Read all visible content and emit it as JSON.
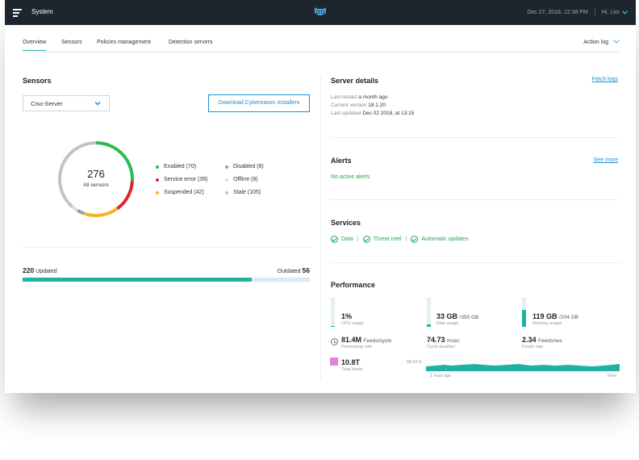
{
  "topbar": {
    "menu_icon": "hamburger-icon",
    "title": "System",
    "logo_icon": "owl-logo-icon",
    "datetime": "Dec 27, 2018, 12:38 PM",
    "user": "Hi, Lior",
    "user_chevron": "⌄"
  },
  "tabs": [
    {
      "label": "Overview",
      "active": true
    },
    {
      "label": "Sensors",
      "active": false
    },
    {
      "label": "Policies management",
      "active": false
    },
    {
      "label": "Detection servers",
      "active": false
    }
  ],
  "action_log": "Action log",
  "sensors": {
    "title": "Sensors",
    "server_select": "Ciso-Server",
    "download_button": "Download Cybereason Installers",
    "total": "276",
    "total_label": "All sensors",
    "legend": [
      {
        "label": "Enabled (70)",
        "color": "#2dba4e",
        "count": 70
      },
      {
        "label": "Disabled (8)",
        "color": "#8a9eaf",
        "count": 8
      },
      {
        "label": "Service error (39)",
        "color": "#e0242e",
        "count": 39
      },
      {
        "label": "Offline (8)",
        "color": "#d7dde2",
        "count": 8
      },
      {
        "label": "Suspended (42)",
        "color": "#f4b42a",
        "count": 42
      },
      {
        "label": "Stale (105)",
        "color": "#bfc4c8",
        "count": 105
      }
    ],
    "updated_count": "220",
    "updated_label": "Updated",
    "outdated_label": "Outdated",
    "outdated_count": "56",
    "updated_fraction": 0.797
  },
  "server_details": {
    "title": "Server details",
    "fetch_logs": "Fetch logs",
    "last_restart_label": "Last restart",
    "last_restart_value": "a month ago",
    "version_label": "Current version",
    "version_value": "18.1.20",
    "updated_label": "Last updated",
    "updated_value": "Dec 02 2018, at 13:15"
  },
  "alerts": {
    "title": "Alerts",
    "see_more": "See more",
    "status": "No active alerts"
  },
  "services": {
    "title": "Services",
    "items": [
      "Data",
      "Threat intel",
      "Automatic updates"
    ],
    "separator": "|"
  },
  "performance": {
    "title": "Performance",
    "cpu": {
      "value": "1%",
      "label": "CPU usage",
      "fraction": 0.02
    },
    "disk": {
      "value": "33 GB",
      "unit": "/350 GB",
      "label": "Disk usage",
      "fraction": 0.094
    },
    "memory": {
      "value": "119 GB",
      "unit": "/204 GB",
      "label": "Memory usage",
      "fraction": 0.583
    },
    "feeds_cycle": {
      "value": "81.4M",
      "unit": "Feeds/cycle",
      "label": "Processing rate"
    },
    "cycle_duration": {
      "value": "74.73",
      "unit": "msec",
      "label": "Cycle duration"
    },
    "feeds_rate": {
      "value": "2.34",
      "unit": "Feeds/sec",
      "label": "Feeds rate"
    },
    "total_feeds": {
      "value": "10.8T",
      "label": "Total feeds"
    },
    "chart_max": "68.93 K",
    "axis_start": "1 hour ago",
    "axis_end": "Now"
  }
}
